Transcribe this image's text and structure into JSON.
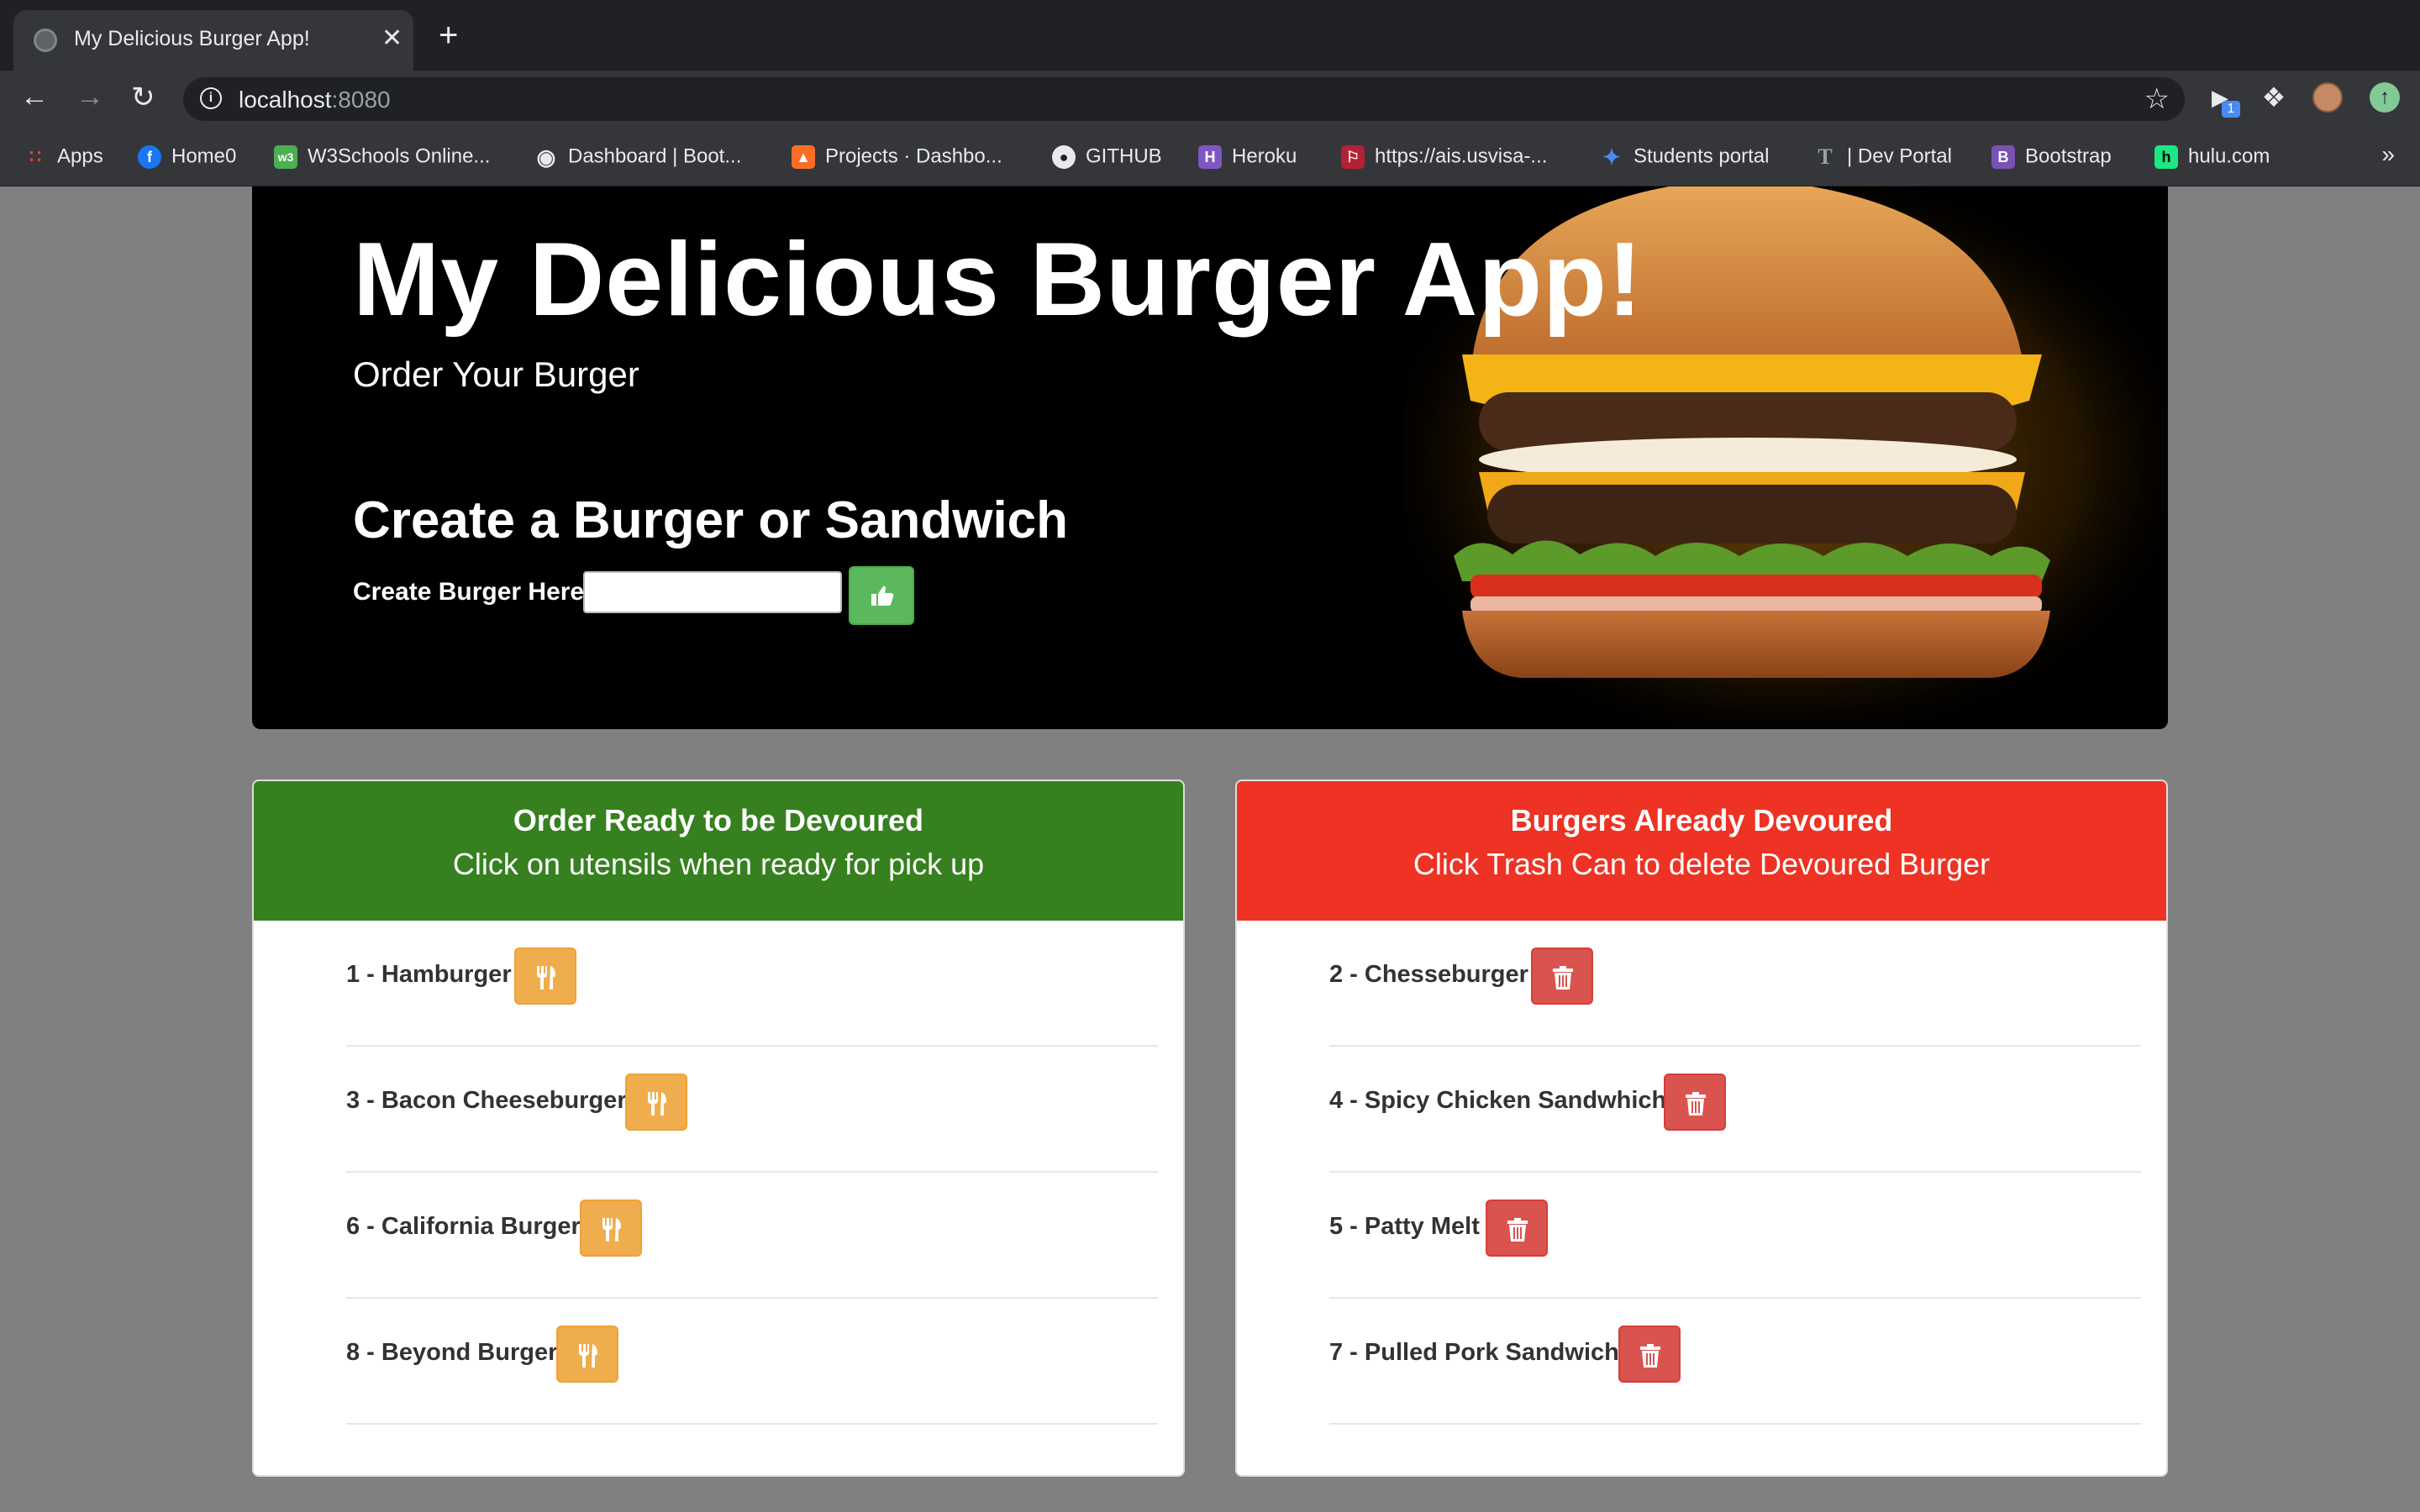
{
  "browser": {
    "tab_title": "My Delicious Burger App!",
    "tab_close": "✕",
    "new_tab": "+",
    "url_host": "localhost",
    "url_port": ":8080",
    "info_icon": "i",
    "ext_badge": "1",
    "bookmarks": [
      {
        "label": "Apps",
        "icon": "apps-grid-icon"
      },
      {
        "label": "Home0",
        "icon": "facebook-icon"
      },
      {
        "label": "W3Schools Online...",
        "icon": "w3schools-icon"
      },
      {
        "label": "Dashboard | Boot...",
        "icon": "globe-icon"
      },
      {
        "label": "Projects · Dashbo...",
        "icon": "gitlab-icon"
      },
      {
        "label": "GITHUB",
        "icon": "github-icon"
      },
      {
        "label": "Heroku",
        "icon": "heroku-icon"
      },
      {
        "label": "https://ais.usvisa-...",
        "icon": "flag-icon"
      },
      {
        "label": "Students portal",
        "icon": "portal-icon"
      },
      {
        "label": "| Dev Portal",
        "icon": "nyt-icon"
      },
      {
        "label": "Bootstrap",
        "icon": "bootstrap-icon"
      },
      {
        "label": "hulu.com",
        "icon": "hulu-icon"
      }
    ],
    "bookmarks_more": "»"
  },
  "page": {
    "title": "My Delicious Burger App!",
    "subtitle": "Order Your Burger",
    "create_heading": "Create a Burger or Sandwich",
    "create_label": "Create Burger Here:",
    "create_input_value": ""
  },
  "ready_panel": {
    "heading": "Order Ready to be Devoured",
    "subheading": "Click on utensils when ready for pick up",
    "items": [
      {
        "label": "1 - Hamburger"
      },
      {
        "label": "3 - Bacon Cheeseburger"
      },
      {
        "label": "6 - California Burger"
      },
      {
        "label": "8 - Beyond Burger"
      }
    ]
  },
  "devoured_panel": {
    "heading": "Burgers Already Devoured",
    "subheading": "Click Trash Can to delete Devoured Burger",
    "items": [
      {
        "label": "2 - Chesseburger"
      },
      {
        "label": "4 - Spicy Chicken Sandwhich"
      },
      {
        "label": "5 - Patty Melt"
      },
      {
        "label": "7 - Pulled Pork Sandwich"
      }
    ]
  },
  "colors": {
    "ready_header": "#36801f",
    "devoured_header": "#ee3223",
    "submit_button": "#5cb85c",
    "eat_button": "#f0ad4e",
    "delete_button": "#d9534f",
    "page_background": "#808080"
  }
}
